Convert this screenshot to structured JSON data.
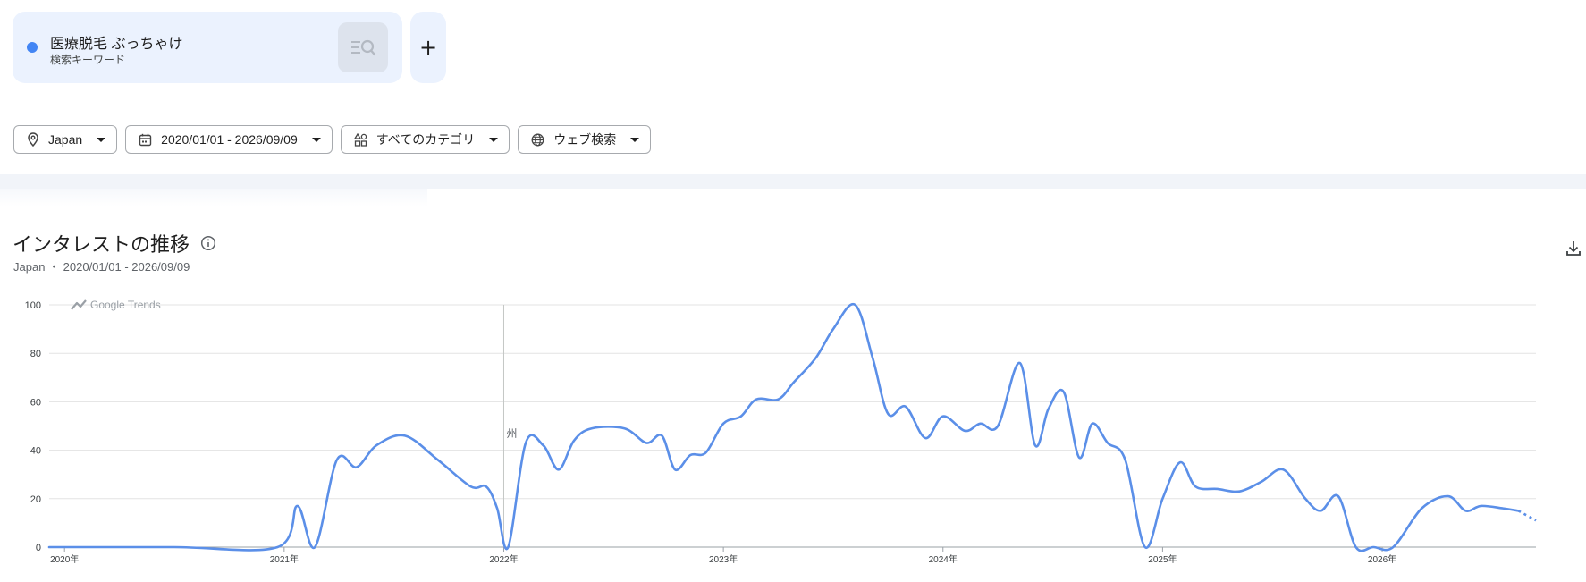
{
  "term": {
    "name": "医療脱毛 ぶっちゃけ",
    "type": "検索キーワード",
    "color": "#4285f4"
  },
  "filters": [
    {
      "icon": "location-pin-icon",
      "label": "Japan"
    },
    {
      "icon": "calendar-icon",
      "label": "2020/01/01 - 2026/09/09"
    },
    {
      "icon": "category-icon",
      "label": "すべてのカテゴリ"
    },
    {
      "icon": "globe-icon",
      "label": "ウェブ検索"
    }
  ],
  "section": {
    "title": "インタレストの推移",
    "subtitle": "Japan ・ 2020/01/01 - 2026/09/09"
  },
  "chart_data": {
    "type": "line",
    "watermark": "Google Trends",
    "annotation": {
      "x": 2022.0,
      "label": "州"
    },
    "ylim": [
      0,
      100
    ],
    "yticks": [
      "0",
      "20",
      "40",
      "60",
      "80",
      "100"
    ],
    "xlim": [
      2019.93,
      2026.7
    ],
    "xticks": [
      {
        "x": 2020.0,
        "label": "2020年"
      },
      {
        "x": 2021.0,
        "label": "2021年"
      },
      {
        "x": 2022.0,
        "label": "2022年"
      },
      {
        "x": 2023.0,
        "label": "2023年"
      },
      {
        "x": 2024.0,
        "label": "2024年"
      },
      {
        "x": 2025.0,
        "label": "2025年"
      },
      {
        "x": 2026.0,
        "label": "2026年"
      }
    ],
    "grid": true,
    "series": [
      {
        "color": "#5b8fe8",
        "x": [
          2019.93,
          2020.5,
          2020.97,
          2021.06,
          2021.14,
          2021.24,
          2021.33,
          2021.42,
          2021.55,
          2021.7,
          2021.85,
          2021.92,
          2021.97,
          2022.02,
          2022.1,
          2022.18,
          2022.25,
          2022.32,
          2022.4,
          2022.55,
          2022.65,
          2022.72,
          2022.78,
          2022.85,
          2022.92,
          2023.0,
          2023.08,
          2023.15,
          2023.25,
          2023.32,
          2023.42,
          2023.5,
          2023.6,
          2023.68,
          2023.75,
          2023.83,
          2023.92,
          2024.0,
          2024.1,
          2024.17,
          2024.25,
          2024.35,
          2024.42,
          2024.48,
          2024.55,
          2024.62,
          2024.68,
          2024.75,
          2024.83,
          2024.92,
          2025.0,
          2025.08,
          2025.15,
          2025.25,
          2025.35,
          2025.45,
          2025.55,
          2025.65,
          2025.72,
          2025.8,
          2025.88,
          2025.96,
          2026.05,
          2026.18,
          2026.3,
          2026.38,
          2026.45,
          2026.55,
          2026.62
        ],
        "y": [
          0,
          0,
          0,
          17,
          0,
          36,
          33,
          42,
          46,
          36,
          25,
          25,
          16,
          0,
          43,
          42,
          32,
          44,
          49,
          49,
          43,
          46,
          32,
          38,
          39,
          51,
          54,
          61,
          61,
          68,
          78,
          90,
          100,
          78,
          55,
          58,
          45,
          54,
          48,
          51,
          50,
          76,
          42,
          57,
          64,
          37,
          51,
          43,
          36,
          0,
          20,
          35,
          25,
          24,
          23,
          27,
          32,
          20,
          15,
          21,
          0,
          0,
          0,
          16,
          21,
          15,
          17,
          16,
          15
        ]
      }
    ],
    "partial": {
      "x": [
        2026.62,
        2026.7
      ],
      "y": [
        15,
        11
      ]
    }
  }
}
